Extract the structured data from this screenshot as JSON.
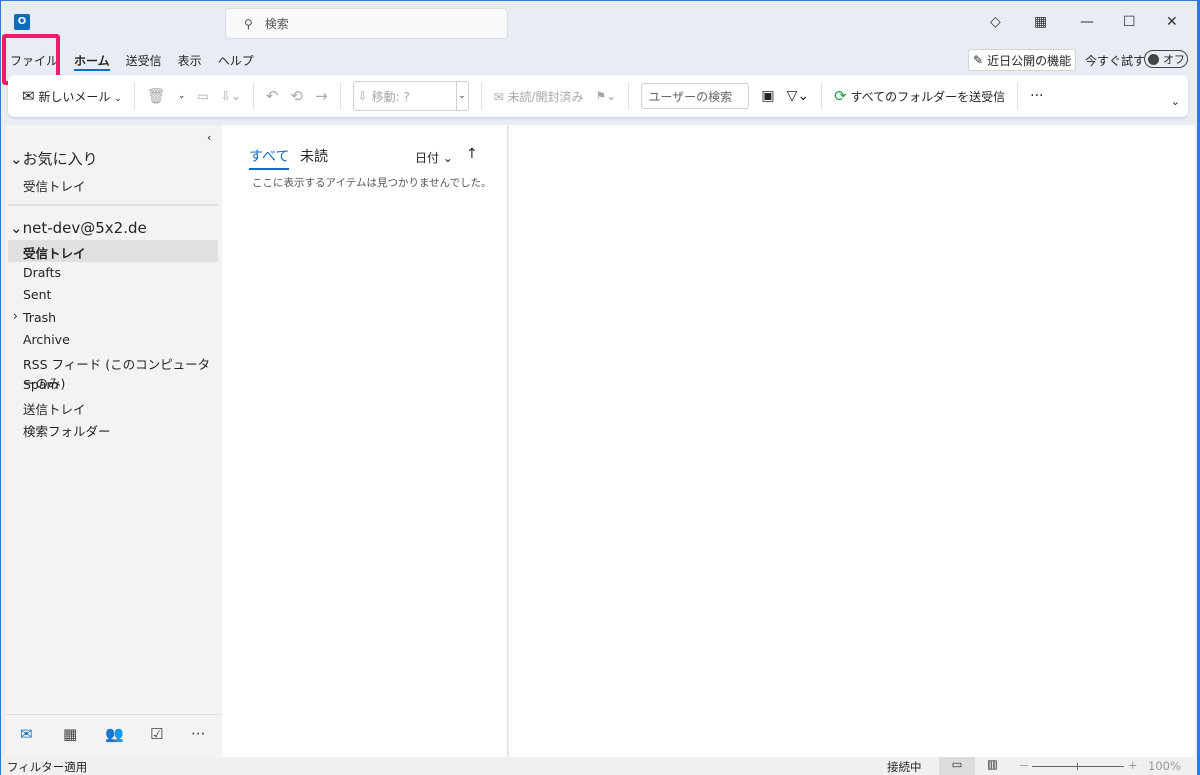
{
  "titlebar": {
    "search_placeholder": "検索"
  },
  "ribbon_tabs": [
    "ファイル",
    "ホーム",
    "送受信",
    "表示",
    "ヘルプ"
  ],
  "coming_soon": {
    "label": "近日公開の機能",
    "try_now": "今すぐ試す",
    "toggle": "オフ"
  },
  "toolbar": {
    "new_mail": "新しいメール",
    "move": "移動: ?",
    "read_unread": "未読/開封済み",
    "search_people": "ユーザーの検索",
    "send_receive_all": "すべてのフォルダーを送受信"
  },
  "sidebar": {
    "favorites": "お気に入り",
    "favorites_items": [
      "受信トレイ"
    ],
    "account": "net-dev@5x2.de",
    "folders": [
      "受信トレイ",
      "Drafts",
      "Sent",
      "Trash",
      "Archive",
      "RSS フィード (このコンピューターのみ)",
      "Spam",
      "送信トレイ",
      "検索フォルダー"
    ]
  },
  "list": {
    "tab_all": "すべて",
    "tab_unread": "未読",
    "sort": "日付",
    "empty": "ここに表示するアイテムは見つかりませんでした。"
  },
  "status": {
    "left": "フィルター適用",
    "connection": "接続中",
    "zoom": "100%"
  },
  "colors": {
    "accent": "#0f6cbd",
    "highlight": "#f5196b"
  }
}
